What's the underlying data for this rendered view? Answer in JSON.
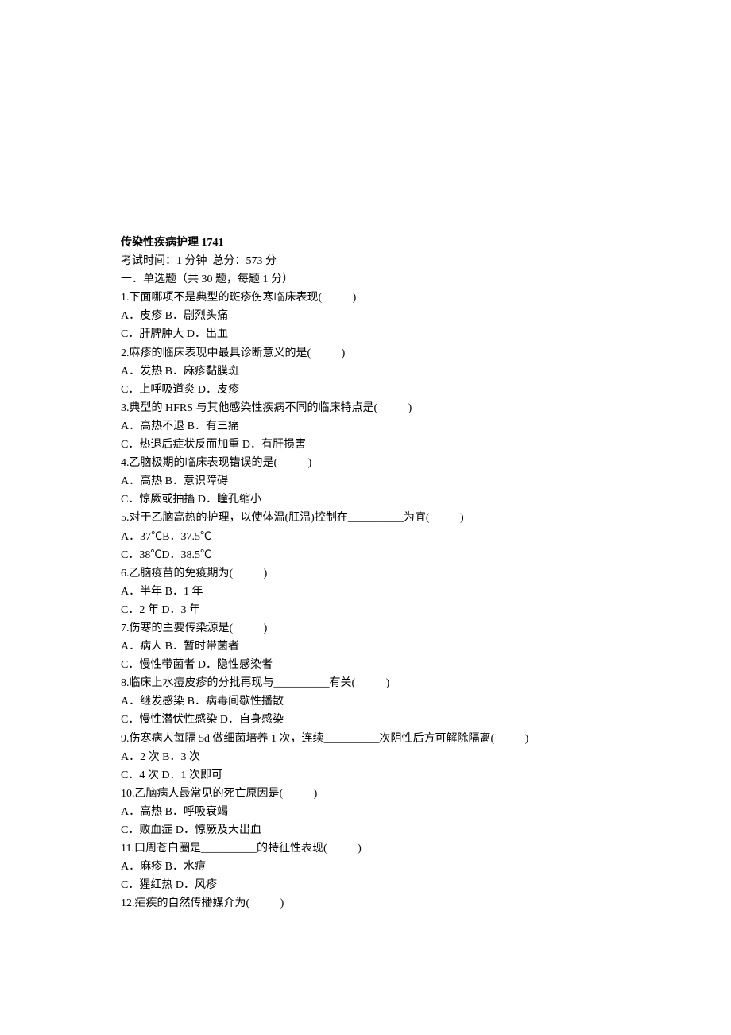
{
  "title": "传染性疾病护理 1741",
  "meta": "考试时间：1 分钟  总分：573 分",
  "section": "一．单选题（共 30 题，每题 1 分）",
  "questions": [
    {
      "q": "1.下面哪项不是典型的斑疹伤寒临床表现(           )",
      "line1": "A．皮疹 B．剧烈头痛",
      "line2": "C．肝脾肿大 D．出血"
    },
    {
      "q": "2.麻疹的临床表现中最具诊断意义的是(           )",
      "line1": "A．发热 B．麻疹黏膜斑",
      "line2": "C．上呼吸道炎 D．皮疹"
    },
    {
      "q": "3.典型的 HFRS 与其他感染性疾病不同的临床特点是(           )",
      "line1": "A．高热不退 B．有三痛",
      "line2": "C．热退后症状反而加重 D．有肝损害"
    },
    {
      "q": "4.乙脑极期的临床表现错误的是(           )",
      "line1": "A．高热 B．意识障碍",
      "line2": "C．惊厥或抽搐 D．瞳孔缩小"
    },
    {
      "q": "5.对于乙脑高热的护理，以使体温(肛温)控制在__________为宜(           )",
      "line1": "A．37℃B．37.5℃",
      "line2": "C．38℃D．38.5℃"
    },
    {
      "q": "6.乙脑疫苗的免疫期为(           )",
      "line1": "A．半年 B．1 年",
      "line2": "C．2 年 D．3 年"
    },
    {
      "q": "7.伤寒的主要传染源是(           )",
      "line1": "A．病人 B．暂时带菌者",
      "line2": "C．慢性带菌者 D．隐性感染者"
    },
    {
      "q": "8.临床上水痘皮疹的分批再现与__________有关(           )",
      "line1": "A．继发感染 B．病毒间歇性播散",
      "line2": "C．慢性潜伏性感染 D．自身感染"
    },
    {
      "q": "9.伤寒病人每隔 5d 做细菌培养 1 次，连续__________次阴性后方可解除隔离(           )",
      "line1": "A．2 次 B．3 次",
      "line2": "C．4 次 D．1 次即可"
    },
    {
      "q": "10.乙脑病人最常见的死亡原因是(           )",
      "line1": "A．高热 B．呼吸衰竭",
      "line2": "C．败血症 D．惊厥及大出血"
    },
    {
      "q": "11.口周苍白圈是__________的特征性表现(           )",
      "line1": "A．麻疹 B．水痘",
      "line2": "C．猩红热 D．风疹"
    },
    {
      "q": "12.疟疾的自然传播媒介为(           )",
      "line1": "",
      "line2": ""
    }
  ]
}
